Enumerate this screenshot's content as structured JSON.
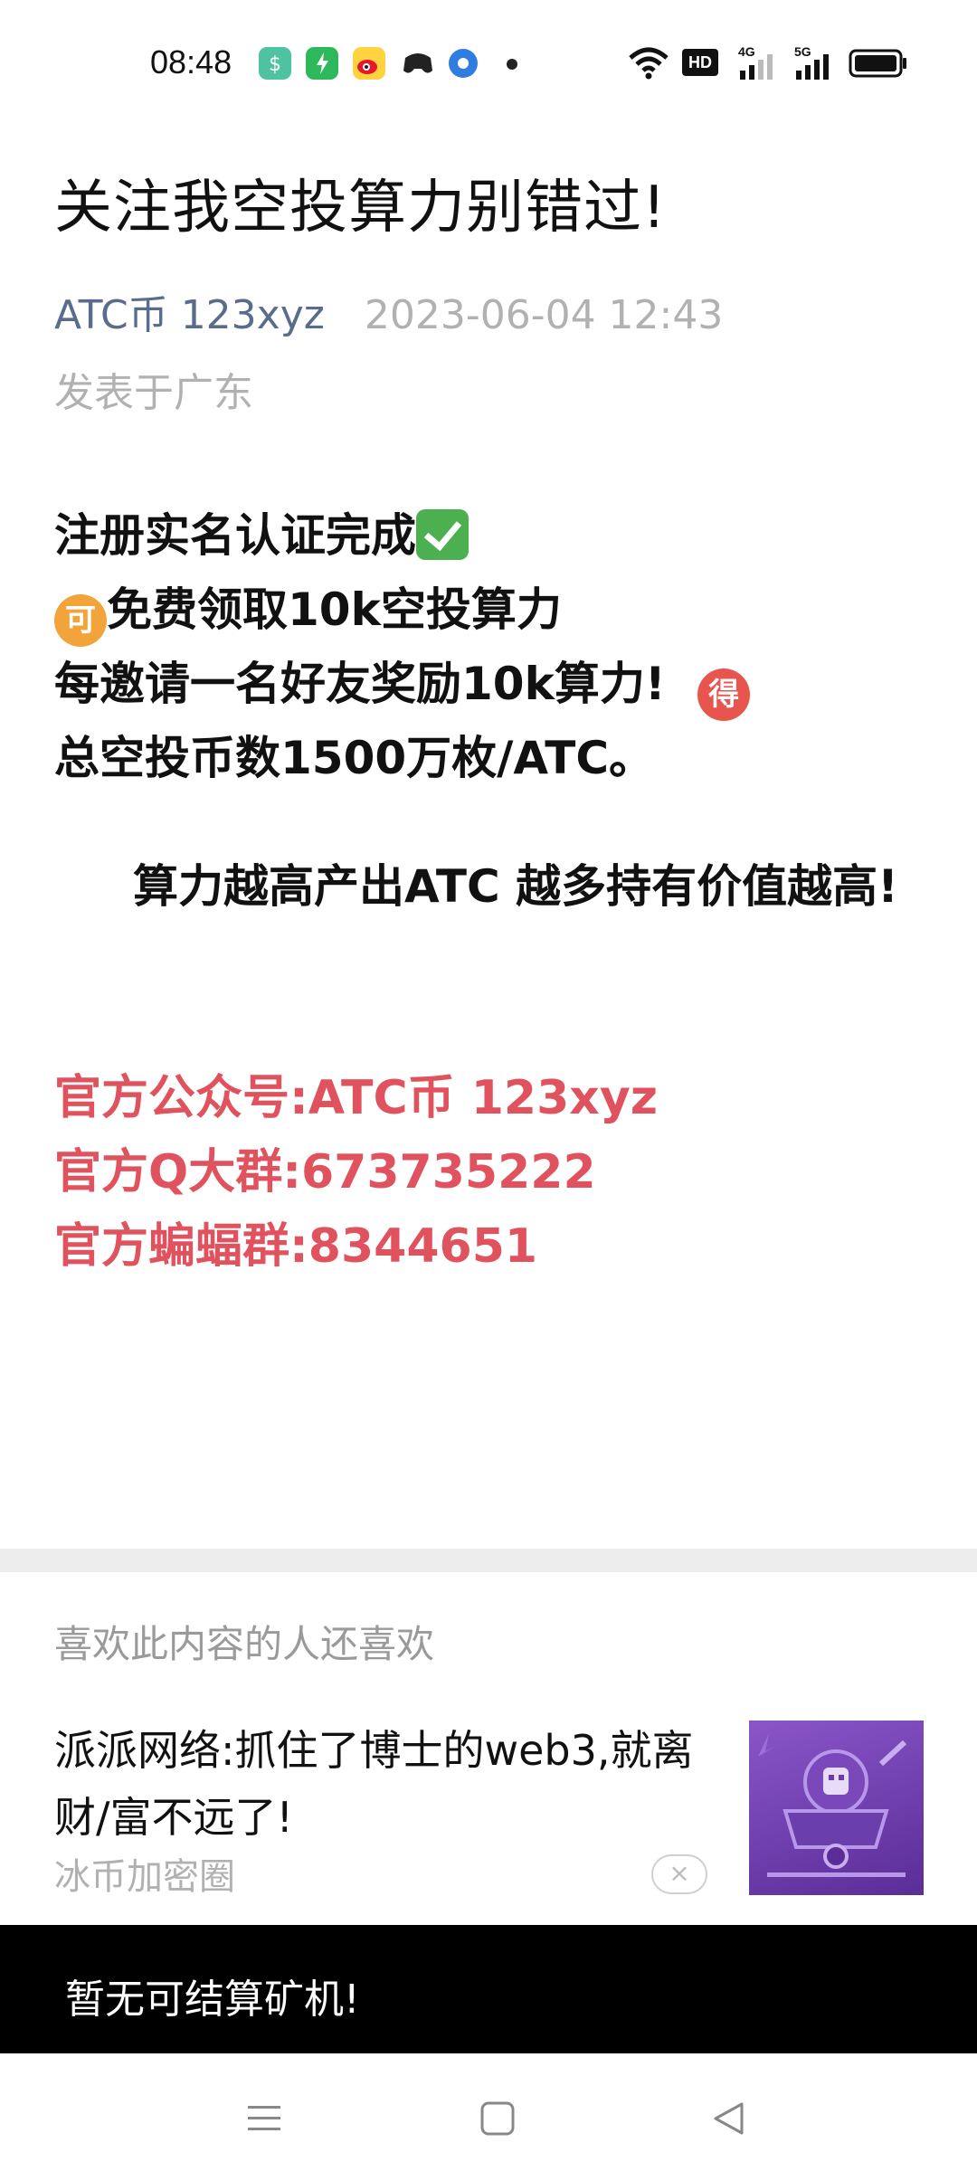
{
  "status_bar": {
    "time": "08:48",
    "app_icons": [
      "money-app-icon",
      "green-power-app-icon",
      "weibo-icon",
      "game-app-icon",
      "blue-circle-app-icon"
    ],
    "right_icons": [
      "wifi-icon",
      "hd-icon",
      "signal-4g-icon",
      "signal-5g-icon",
      "battery-icon"
    ]
  },
  "article": {
    "title": "关注我空投算力别错过!",
    "author": "ATC币 123xyz",
    "date": "2023-06-04 12:43",
    "location": "发表于广东",
    "lines": [
      "注册实名认证完成",
      "免费领取10k空投算力",
      "每邀请一名好友奖励10k算力!",
      "总空投币数1500万枚/ATC。",
      " 算力越高产出ATC 越多持有价值越高!"
    ],
    "emoji": {
      "check": "check-mark-icon",
      "ke": "可",
      "de": "得"
    },
    "contacts": [
      "官方公众号:ATC币 123xyz",
      "官方Q大群:673735222",
      "官方蝙蝠群:8344651"
    ]
  },
  "recommend": {
    "header": "喜欢此内容的人还喜欢",
    "items": [
      {
        "title": "派派网络:抓住了博士的web3,就离财/富不远了!",
        "source": "冰币加密圈",
        "close": "×",
        "thumb_icon": "mining-cart-icon"
      }
    ]
  },
  "toast": {
    "text": "暂无可结算矿机!"
  },
  "navbar": {
    "icons": [
      "menu-icon",
      "home-square-icon",
      "back-triangle-icon"
    ]
  },
  "colors": {
    "contact_red": "#e0535e",
    "author_blue": "#5a6c8e",
    "meta_gray": "#b1b1b1",
    "ke_orange": "#f2a33a",
    "de_red": "#e8554f"
  }
}
